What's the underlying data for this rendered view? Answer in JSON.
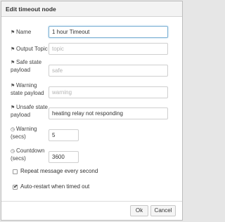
{
  "dialog": {
    "title": "Edit timeout node"
  },
  "form": {
    "name": {
      "icon": "tag-icon",
      "label": "Name",
      "value": "1 hour Timeout",
      "placeholder": ""
    },
    "output_topic": {
      "icon": "tag-icon",
      "label": "Output Topic",
      "value": "",
      "placeholder": "topic"
    },
    "safe_payload": {
      "icon": "tag-icon",
      "label_line1": "Safe state",
      "label_line2": "payload",
      "value": "",
      "placeholder": "safe"
    },
    "warning_payload": {
      "icon": "tag-icon",
      "label_line1": "Warning",
      "label_line2": "state payload",
      "value": "",
      "placeholder": "warning"
    },
    "unsafe_payload": {
      "icon": "tag-icon",
      "label_line1": "Unsafe state",
      "label_line2": "payload",
      "value": "heating relay not responding",
      "placeholder": ""
    },
    "warning_secs": {
      "icon": "clock-icon",
      "label_line1": "Warning",
      "label_line2": "(secs)",
      "value": "5"
    },
    "countdown_secs": {
      "icon": "clock-icon",
      "label_line1": "Countdown",
      "label_line2": "(secs)",
      "value": "3600"
    },
    "repeat": {
      "label": "Repeat message every second",
      "checked": false
    },
    "autorestart": {
      "label": "Auto-restart when timed out",
      "checked": true
    }
  },
  "buttons": {
    "ok": "Ok",
    "cancel": "Cancel"
  },
  "icons": {
    "tag": "🏷",
    "clock": "⏱",
    "check": "✔"
  }
}
